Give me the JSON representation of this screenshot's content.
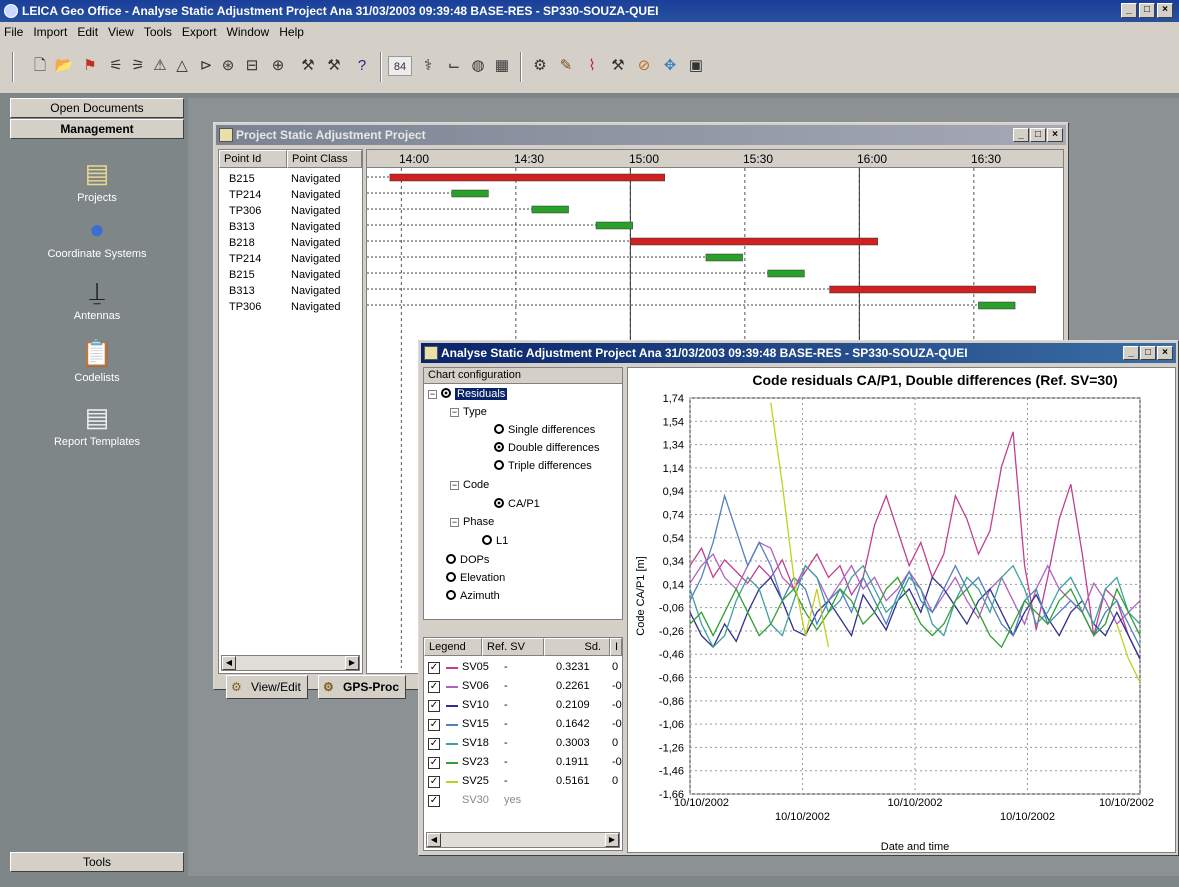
{
  "app": {
    "title": "LEICA Geo Office - Analyse Static Adjustment Project Ana 31/03/2003 09:39:48 BASE-RES - SP330-SOUZA-QUEI",
    "min": "_",
    "max": "□",
    "close": "×"
  },
  "menu": [
    "File",
    "Import",
    "Edit",
    "View",
    "Tools",
    "Export",
    "Window",
    "Help"
  ],
  "toolbar": {
    "icons": [
      "new-icon",
      "open-icon",
      "project-icon",
      "compute-icon",
      "compute2-icon",
      "adjust-icon",
      "triangle-icon",
      "tool1-icon",
      "tool2-icon",
      "box-icon",
      "tool3-icon",
      "tool4-icon",
      "tool5-icon",
      "help-icon",
      "number-icon",
      "tool6-icon",
      "graph-icon",
      "globe-icon",
      "grid-icon",
      "tool7-icon",
      "tool8-icon",
      "tool9-icon",
      "tool10-icon",
      "tool11-icon",
      "tool12-icon",
      "save-icon"
    ],
    "number_box": "84"
  },
  "left_panel": {
    "open_documents": "Open Documents",
    "management": "Management",
    "items": [
      {
        "label": "Projects",
        "icon": "projects-icon"
      },
      {
        "label": "Coordinate Systems",
        "icon": "globe-icon"
      },
      {
        "label": "Antennas",
        "icon": "antenna-icon"
      },
      {
        "label": "Codelists",
        "icon": "clipboard-icon"
      },
      {
        "label": "Report Templates",
        "icon": "report-icon"
      }
    ],
    "tools": "Tools"
  },
  "project_window": {
    "title": "Project Static Adjustment Project",
    "columns": [
      "Point Id",
      "Point Class"
    ],
    "rows": [
      {
        "id": "B215",
        "cls": "Navigated"
      },
      {
        "id": "TP214",
        "cls": "Navigated"
      },
      {
        "id": "TP306",
        "cls": "Navigated"
      },
      {
        "id": "B313",
        "cls": "Navigated"
      },
      {
        "id": "B218",
        "cls": "Navigated"
      },
      {
        "id": "TP214",
        "cls": "Navigated"
      },
      {
        "id": "B215",
        "cls": "Navigated"
      },
      {
        "id": "B313",
        "cls": "Navigated"
      },
      {
        "id": "TP306",
        "cls": "Navigated"
      }
    ],
    "time_ticks": [
      "14:00",
      "14:30",
      "15:00",
      "15:30",
      "16:00",
      "16:30"
    ],
    "bars": [
      {
        "row": 0,
        "start": 13.95,
        "end": 15.15,
        "color": "#d02020"
      },
      {
        "row": 1,
        "start": 14.22,
        "end": 14.38,
        "color": "#2aa02a"
      },
      {
        "row": 2,
        "start": 14.57,
        "end": 14.73,
        "color": "#2aa02a"
      },
      {
        "row": 3,
        "start": 14.85,
        "end": 15.01,
        "color": "#2aa02a"
      },
      {
        "row": 4,
        "start": 15.0,
        "end": 16.08,
        "color": "#d02020"
      },
      {
        "row": 5,
        "start": 15.33,
        "end": 15.49,
        "color": "#2aa02a"
      },
      {
        "row": 6,
        "start": 15.6,
        "end": 15.76,
        "color": "#2aa02a"
      },
      {
        "row": 7,
        "start": 15.87,
        "end": 16.77,
        "color": "#d02020"
      },
      {
        "row": 8,
        "start": 16.52,
        "end": 16.68,
        "color": "#2aa02a"
      }
    ],
    "tabs": [
      "View/Edit",
      "GPS-Proc"
    ]
  },
  "analyse_window": {
    "title": "Analyse Static Adjustment Project Ana 31/03/2003 09:39:48 BASE-RES - SP330-SOUZA-QUEI",
    "config_header": "Chart configuration",
    "tree": {
      "residuals": "Residuals",
      "type": "Type",
      "single": "Single differences",
      "double": "Double differences",
      "triple": "Triple differences",
      "code": "Code",
      "cap1": "CA/P1",
      "phase": "Phase",
      "l1": "L1",
      "dops": "DOPs",
      "elevation": "Elevation",
      "azimuth": "Azimuth"
    },
    "legend_columns": [
      "Legend",
      "Ref. SV",
      "Sd.",
      "I"
    ],
    "legend_rows": [
      {
        "sv": "SV05",
        "ref": "-",
        "sd": "0.3231",
        "x": "0",
        "color": "#c04090"
      },
      {
        "sv": "SV06",
        "ref": "-",
        "sd": "0.2261",
        "x": "-0",
        "color": "#b060c0"
      },
      {
        "sv": "SV10",
        "ref": "-",
        "sd": "0.2109",
        "x": "-0",
        "color": "#303090"
      },
      {
        "sv": "SV15",
        "ref": "-",
        "sd": "0.1642",
        "x": "-0",
        "color": "#5080c0"
      },
      {
        "sv": "SV18",
        "ref": "-",
        "sd": "0.3003",
        "x": "0",
        "color": "#40a0a0"
      },
      {
        "sv": "SV23",
        "ref": "-",
        "sd": "0.1911",
        "x": "-0",
        "color": "#30a030"
      },
      {
        "sv": "SV25",
        "ref": "-",
        "sd": "0.5161",
        "x": "0",
        "color": "#c0d020"
      },
      {
        "sv": "SV30",
        "ref": "yes",
        "sd": "",
        "x": "",
        "color": ""
      }
    ]
  },
  "chart_data": {
    "type": "line",
    "title": "Code residuals CA/P1, Double differences (Ref. SV=30)",
    "ylabel": "Code CA/P1 [m]",
    "xlabel": "Date and time",
    "ylim": [
      -1.66,
      1.74
    ],
    "yticks": [
      "1,74",
      "1,54",
      "1,34",
      "1,14",
      "0,94",
      "0,74",
      "0,54",
      "0,34",
      "0,14",
      "-0,06",
      "-0,26",
      "-0,46",
      "-0,66",
      "-0,86",
      "-1,06",
      "-1,26",
      "-1,46",
      "-1,66"
    ],
    "xticks": [
      {
        "label": "10/10/2002",
        "pos": 0.0,
        "row": 0
      },
      {
        "label": "10/10/2002",
        "pos": 0.25,
        "row": 1
      },
      {
        "label": "10/10/2002",
        "pos": 0.5,
        "row": 0
      },
      {
        "label": "10/10/2002",
        "pos": 0.75,
        "row": 1
      },
      {
        "label": "10/10/2002",
        "pos": 1.0,
        "row": 0
      }
    ],
    "grid": true,
    "series": [
      {
        "name": "SV05",
        "color": "#c04090",
        "values": [
          0.3,
          0.45,
          0.2,
          0.35,
          0.25,
          0.15,
          0.3,
          0.2,
          0.35,
          0.1,
          0.25,
          0.4,
          0.2,
          0.3,
          0.05,
          0.2,
          0.65,
          0.9,
          0.6,
          0.3,
          0.5,
          0.2,
          0.4,
          0.9,
          0.7,
          0.4,
          0.6,
          1.15,
          1.45,
          0.3,
          -0.25,
          0.2,
          0.7,
          1.0,
          0.4,
          -0.3,
          0.1,
          0.0,
          -0.3,
          -0.5
        ]
      },
      {
        "name": "SV06",
        "color": "#b060c0",
        "values": [
          0.15,
          0.3,
          0.4,
          0.2,
          0.1,
          0.3,
          0.5,
          0.45,
          0.2,
          0.1,
          0.3,
          0.2,
          0.0,
          0.15,
          0.3,
          0.1,
          0.2,
          0.0,
          0.1,
          0.25,
          0.1,
          -0.1,
          0.05,
          0.2,
          0.0,
          -0.15,
          0.1,
          0.2,
          0.0,
          -0.2,
          0.1,
          0.3,
          0.1,
          0.0,
          -0.1,
          0.15,
          0.0,
          -0.2,
          -0.1,
          0.0
        ]
      },
      {
        "name": "SV10",
        "color": "#303090",
        "values": [
          -0.1,
          -0.3,
          -0.4,
          -0.2,
          -0.35,
          -0.1,
          0.1,
          0.2,
          0.0,
          -0.25,
          -0.3,
          -0.1,
          0.0,
          -0.15,
          -0.3,
          0.05,
          -0.1,
          -0.25,
          0.0,
          0.1,
          -0.1,
          0.2,
          0.1,
          -0.05,
          -0.2,
          0.0,
          0.1,
          -0.1,
          -0.3,
          -0.1,
          0.05,
          -0.15,
          -0.3,
          -0.1,
          0.0,
          -0.2,
          -0.3,
          -0.1,
          -0.3,
          -0.5
        ]
      },
      {
        "name": "SV15",
        "color": "#5080c0",
        "values": [
          0.0,
          0.2,
          0.5,
          0.9,
          0.6,
          0.3,
          0.5,
          0.3,
          0.0,
          0.2,
          0.1,
          -0.2,
          0.0,
          0.1,
          -0.1,
          0.2,
          0.0,
          -0.2,
          0.05,
          0.25,
          0.0,
          -0.1,
          0.1,
          0.3,
          0.1,
          0.2,
          0.0,
          -0.2,
          -0.3,
          0.0,
          0.1,
          -0.2,
          -0.1,
          0.0,
          -0.1,
          -0.3,
          -0.1,
          0.0,
          -0.2,
          -0.4
        ]
      },
      {
        "name": "SV18",
        "color": "#40a0a0",
        "values": [
          0.1,
          -0.2,
          -0.4,
          -0.3,
          0.0,
          0.2,
          0.1,
          -0.2,
          -0.3,
          0.0,
          0.3,
          0.2,
          -0.1,
          0.0,
          0.2,
          0.3,
          0.1,
          -0.1,
          0.0,
          0.2,
          0.1,
          -0.2,
          -0.3,
          0.0,
          0.2,
          0.1,
          -0.1,
          0.2,
          0.3,
          0.1,
          -0.2,
          -0.1,
          0.1,
          0.2,
          0.0,
          -0.2,
          0.1,
          0.2,
          -0.1,
          -0.2
        ]
      },
      {
        "name": "SV23",
        "color": "#30a030",
        "values": [
          -0.2,
          -0.1,
          -0.3,
          -0.1,
          0.1,
          -0.1,
          -0.3,
          -0.2,
          0.0,
          0.1,
          -0.1,
          -0.25,
          -0.1,
          0.1,
          0.0,
          -0.2,
          -0.1,
          0.1,
          0.2,
          0.0,
          -0.2,
          -0.3,
          -0.2,
          0.0,
          0.1,
          -0.1,
          -0.3,
          -0.4,
          -0.2,
          0.0,
          -0.1,
          -0.2,
          0.0,
          0.1,
          -0.1,
          -0.3,
          -0.2,
          0.1,
          -0.1,
          -0.3
        ]
      },
      {
        "name": "SV25",
        "color": "#c0d020",
        "values": [
          null,
          null,
          null,
          null,
          null,
          null,
          null,
          1.7,
          1.0,
          0.2,
          -0.3,
          0.1,
          -0.4,
          null,
          null,
          null,
          null,
          null,
          null,
          null,
          null,
          null,
          null,
          null,
          null,
          null,
          null,
          null,
          null,
          null,
          null,
          null,
          null,
          null,
          null,
          null,
          null,
          -0.2,
          -0.5,
          -0.7
        ]
      }
    ]
  }
}
